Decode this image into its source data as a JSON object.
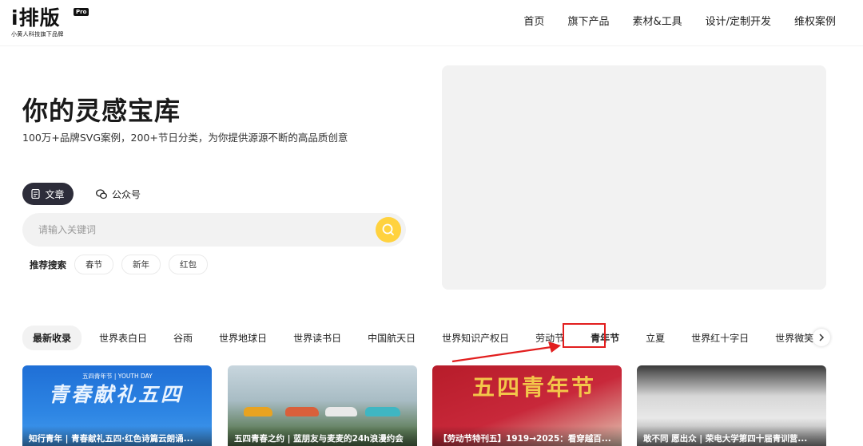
{
  "logo": {
    "main": "i排版",
    "badge": "Pro",
    "sub": "小黄人科技旗下品牌"
  },
  "nav": [
    "首页",
    "旗下产品",
    "素材&工具",
    "设计/定制开发",
    "维权案例"
  ],
  "hero": {
    "title": "你的灵感宝库",
    "subtitle": "100万+品牌SVG案例，200+节日分类，为你提供源源不断的高品质创意"
  },
  "tabs": {
    "article": "文章",
    "wechat": "公众号"
  },
  "search": {
    "placeholder": "请输入关键词"
  },
  "recommend": {
    "label": "推荐搜索",
    "chips": [
      "春节",
      "新年",
      "红包"
    ]
  },
  "categories": [
    "最新收录",
    "世界表白日",
    "谷雨",
    "世界地球日",
    "世界读书日",
    "中国航天日",
    "世界知识产权日",
    "劳动节",
    "青年节",
    "立夏",
    "世界红十字日",
    "世界微笑日"
  ],
  "cards": [
    {
      "caption": "知行青年 | 青春献礼五四·红色诗篇云朗诵...",
      "tag": "五四青年节 | YOUTH DAY",
      "art": "青春献礼五四"
    },
    {
      "caption": "五四青春之约 | 蓝朋友与麦麦的24h浪漫约会"
    },
    {
      "caption": "【劳动节特刊五】1919→2025：看穿越百...",
      "art": "五四青年节"
    },
    {
      "caption": "敢不同 愿出众 | 荣电大学第四十届青训营..."
    }
  ],
  "colors": {
    "accent": "#ffd23f",
    "dark": "#2d2d3a",
    "highlight": "#e21e1e"
  }
}
